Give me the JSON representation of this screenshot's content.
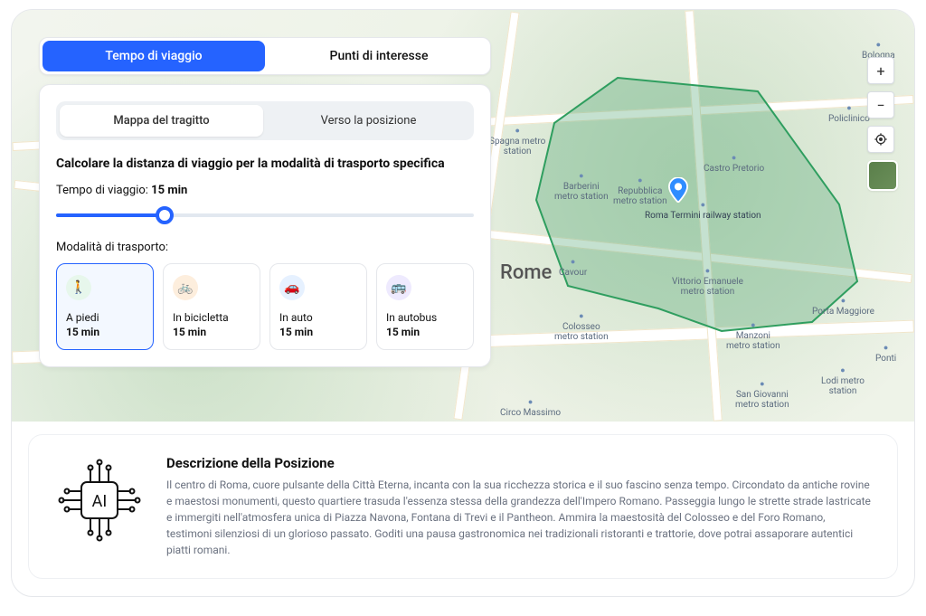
{
  "tabs_primary": {
    "travel": "Tempo di viaggio",
    "poi": "Punti di interesse"
  },
  "tabs_secondary": {
    "route": "Mappa del tragitto",
    "to_pos": "Verso la posizione"
  },
  "panel": {
    "title": "Calcolare la distanza di viaggio per la modalità di trasporto specifica",
    "time_label": "Tempo di viaggio:",
    "time_value": "15 min",
    "modes_label": "Modalità di trasporto:"
  },
  "modes": {
    "walk": {
      "label": "A piedi",
      "duration": "15 min"
    },
    "bike": {
      "label": "In bicicletta",
      "duration": "15 min"
    },
    "car": {
      "label": "In auto",
      "duration": "15 min"
    },
    "bus": {
      "label": "In autobus",
      "duration": "15 min"
    }
  },
  "map": {
    "city": "Rome",
    "pin_label": "Roma Termini railway station",
    "pois": {
      "spagna": "Spagna metro\nstation",
      "barberini": "Barberini\nmetro station",
      "repubblica": "Repubblica\nmetro station",
      "castro": "Castro Pretorio",
      "cavour": "Cavour",
      "colosseo": "Colosseo\nmetro station",
      "vittorio": "Vittorio Emanuele\nmetro station",
      "manzoni": "Manzoni\nmetro station",
      "circo": "Circo Massimo",
      "porta": "Porta Maggiore",
      "lodi": "Lodi metro\nstation",
      "sgiov": "San Giovanni\nmetro station",
      "policlin": "Policlinico",
      "bologna": "Bologna",
      "ponte": "Ponti"
    },
    "controls": {
      "zoom_in": "+",
      "zoom_out": "−"
    }
  },
  "description": {
    "heading": "Descrizione della Posizione",
    "body": "Il centro di Roma, cuore pulsante della Città Eterna, incanta con la sua ricchezza storica e il suo fascino senza tempo. Circondato da antiche rovine e maestosi monumenti, questo quartiere trasuda l'essenza stessa della grandezza dell'Impero Romano. Passeggia lungo le strette strade lastricate e immergiti nell'atmosfera unica di Piazza Navona, Fontana di Trevi e il Pantheon. Ammira la maestosità del Colosseo e del Foro Romano, testimoni silenziosi di un glorioso passato. Goditi una pausa gastronomica nei tradizionali ristoranti e trattorie, dove potrai assaporare autentici piatti romani."
  }
}
